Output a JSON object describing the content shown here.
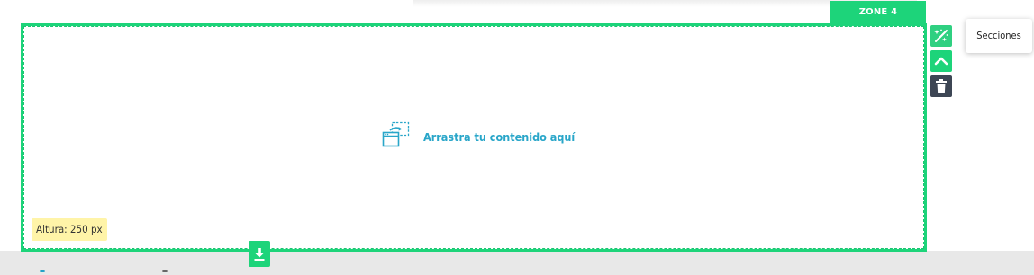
{
  "zone": {
    "tab_label": "ZONE 4",
    "drop_text": "Arrastra tu contenido aquí",
    "height_label": "Altura: 250 px"
  },
  "tooltip": {
    "label": "Secciones"
  },
  "toolbar": {
    "buttons": [
      {
        "icon": "magic-wand-icon",
        "color": "#2fd081"
      },
      {
        "icon": "chevron-up-icon",
        "color": "#1dd47a"
      },
      {
        "icon": "trash-icon",
        "color": "#3d4654"
      }
    ]
  },
  "colors": {
    "accent": "#1dd47a",
    "drop_text": "#29a6c9",
    "height_badge": "#fff4a8",
    "dark_button": "#3d4654"
  }
}
